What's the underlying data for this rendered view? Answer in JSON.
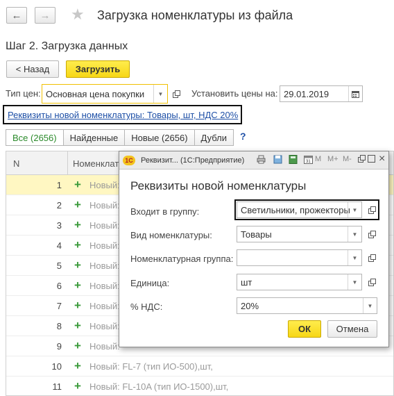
{
  "window": {
    "title": "Загрузка номенклатуры из файла"
  },
  "step": {
    "title": "Шаг 2. Загрузка данных"
  },
  "toolbar": {
    "back_label": "< Назад",
    "load_label": "Загрузить"
  },
  "price": {
    "type_label": "Тип цен:",
    "type_value": "Основная цена покупки",
    "set_prices_label": "Установить цены на:",
    "date_value": "29.01.2019"
  },
  "requisites_link": "Реквизиты новой номенклатуры: Товары, шт, НДС 20%",
  "tabs": [
    {
      "label": "Все (2656)",
      "active": true
    },
    {
      "label": "Найденные",
      "active": false
    },
    {
      "label": "Новые (2656)",
      "active": false
    },
    {
      "label": "Дубли",
      "active": false
    }
  ],
  "help_label": "?",
  "table": {
    "columns": [
      "N",
      "Номенклатура"
    ],
    "rows": [
      {
        "n": "1",
        "text": "Новый:"
      },
      {
        "n": "2",
        "text": "Новый:"
      },
      {
        "n": "3",
        "text": "Новый:"
      },
      {
        "n": "4",
        "text": "Новый:"
      },
      {
        "n": "5",
        "text": "Новый:"
      },
      {
        "n": "6",
        "text": "Новый:"
      },
      {
        "n": "7",
        "text": "Новый:"
      },
      {
        "n": "8",
        "text": "Новый:"
      },
      {
        "n": "9",
        "text": "Новый:"
      },
      {
        "n": "10",
        "text": "Новый: FL-7 (тип ИО-500),шт,"
      },
      {
        "n": "11",
        "text": "Новый: FL-10A (тип ИО-1500),шт,"
      }
    ],
    "selected_row": 0
  },
  "dialog": {
    "window_title": "Реквизит... (1С:Предприятие)",
    "toolbar_icons": [
      "print-icon",
      "save-icon",
      "calculator-icon",
      "calendar-icon",
      "m-icon",
      "m-plus-icon",
      "m-minus-icon",
      "restore-icon",
      "maximize-icon",
      "close-icon"
    ],
    "toolbar_texts": {
      "m": "M",
      "m_plus": "M+",
      "m_minus": "M-",
      "close": "×"
    },
    "heading": "Реквизиты новой номенклатуры",
    "fields": {
      "group": {
        "label": "Входит в группу:",
        "value": "Светильники, прожекторы"
      },
      "kind": {
        "label": "Вид номенклатуры:",
        "value": "Товары"
      },
      "nom_group": {
        "label": "Номенклатурная группа:",
        "value": ""
      },
      "unit": {
        "label": "Единица:",
        "value": "шт"
      },
      "vat": {
        "label": "% НДС:",
        "value": "20%"
      }
    },
    "ok_label": "ОК",
    "cancel_label": "Отмена"
  },
  "colors": {
    "accent": "#f7d716",
    "link": "#1d4fa6",
    "highlight_border": "#111111",
    "active_tab": "#2b8a2b",
    "selected_row": "#fff7c2"
  }
}
